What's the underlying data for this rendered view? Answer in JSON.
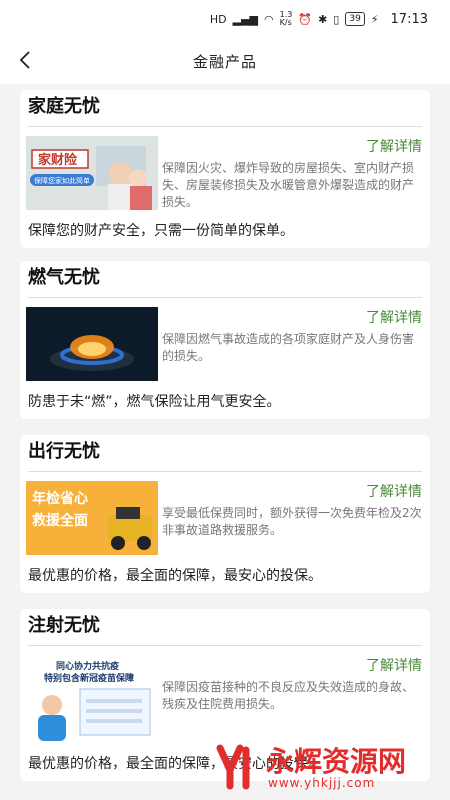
{
  "status_bar": {
    "net_speed": "1.3\nK/s",
    "battery": "39",
    "time": "17:13"
  },
  "header": {
    "title": "金融产品"
  },
  "products": [
    {
      "title": "家庭无忧",
      "detail_label": "了解详情",
      "desc": "保障因火灾、爆炸导致的房屋损失、室内财产损失、房屋装修损失及水暖管意外爆裂造成的财产损失。",
      "slogan": "保障您的财产安全，只需一份简单的保单。",
      "image_text": [
        "家财险",
        "保障您家如此简单"
      ]
    },
    {
      "title": "燃气无忧",
      "detail_label": "了解详情",
      "desc": "保障因燃气事故造成的各项家庭财产及人身伤害的损失。",
      "slogan": "防患于未“燃”，燃气保险让用气更安全。",
      "image_text": []
    },
    {
      "title": "出行无忧",
      "detail_label": "了解详情",
      "desc": "享受最低保费同时，额外获得一次免费年检及2次非事故道路救援服务。",
      "slogan": "最优惠的价格，最全面的保障，最安心的投保。",
      "image_text": [
        "年检省心",
        "救援全面"
      ]
    },
    {
      "title": "注射无忧",
      "detail_label": "了解详情",
      "desc": "保障因疫苗接种的不良反应及失效造成的身故、残疾及住院费用损失。",
      "slogan": "最优惠的价格，最全面的保障，最安心的投保。",
      "image_text": [
        "同心协力共抗疫",
        "特别包含新冠疫苗保障"
      ]
    }
  ],
  "watermark": {
    "text": "永辉资源网",
    "url": "www.yhkjjj.com"
  }
}
